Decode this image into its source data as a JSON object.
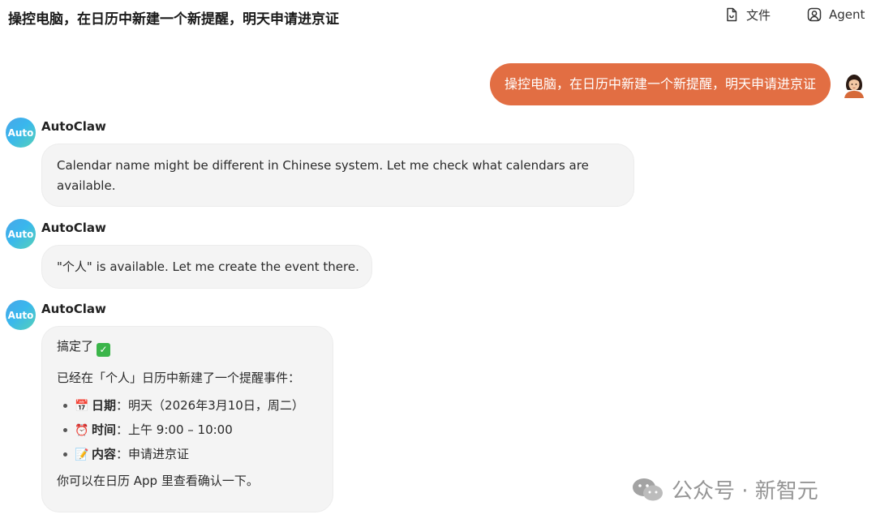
{
  "header": {
    "title": "操控电脑，在日历中新建一个新提醒，明天申请进京证",
    "file_label": "文件",
    "agent_label": "Agent"
  },
  "user_message": {
    "text": "操控电脑，在日历中新建一个新提醒，明天申请进京证",
    "bubble_color": "#e26e43"
  },
  "bot": {
    "name": "AutoClaw",
    "avatar_text": "Auto"
  },
  "messages": [
    {
      "text": "Calendar name might be different in Chinese system. Let me check what calendars are available."
    },
    {
      "text": "\"个人\" is available. Let me create the event there."
    },
    {
      "done_text": "搞定了",
      "done_icon": "check-mark-button-icon",
      "intro": "已经在「个人」日历中新建了一个提醒事件：",
      "items": [
        {
          "icon": "calendar-icon",
          "label": "日期",
          "sep": "：",
          "value": "明天（2026年3月10日，周二）"
        },
        {
          "icon": "alarm-clock-icon",
          "label": "时间",
          "sep": "：",
          "value": "上午 9:00 – 10:00"
        },
        {
          "icon": "memo-icon",
          "label": "内容",
          "sep": "：",
          "value": "申请进京证"
        }
      ],
      "footer": "你可以在日历 App 里查看确认一下。"
    }
  ],
  "watermark": {
    "text": "公众号 · 新智元"
  }
}
